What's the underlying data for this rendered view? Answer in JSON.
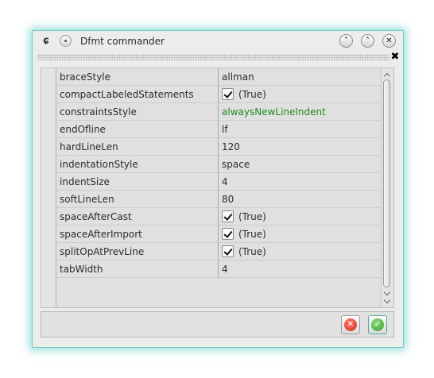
{
  "window": {
    "title": "Dfmt commander",
    "app_icon_glyph": "ɕ",
    "controls": {
      "minimize": "˅",
      "maximize": "˄",
      "close": "✕"
    },
    "dock_close": "✖"
  },
  "properties": [
    {
      "name": "braceStyle",
      "type": "text",
      "value": "allman"
    },
    {
      "name": "compactLabeledStatements",
      "type": "bool",
      "value": "(True)"
    },
    {
      "name": "constraintsStyle",
      "type": "enum",
      "value": "alwaysNewLineIndent",
      "color": "#1f8a1f"
    },
    {
      "name": "endOfline",
      "type": "text",
      "value": "lf"
    },
    {
      "name": "hardLineLen",
      "type": "text",
      "value": "120"
    },
    {
      "name": "indentationStyle",
      "type": "text",
      "value": "space"
    },
    {
      "name": "indentSize",
      "type": "text",
      "value": "4"
    },
    {
      "name": "softLineLen",
      "type": "text",
      "value": "80"
    },
    {
      "name": "spaceAfterCast",
      "type": "bool",
      "value": "(True)"
    },
    {
      "name": "spaceAfterImport",
      "type": "bool",
      "value": "(True)"
    },
    {
      "name": "splitOpAtPrevLine",
      "type": "bool",
      "value": "(True)"
    },
    {
      "name": "tabWidth",
      "type": "text",
      "value": "4"
    }
  ],
  "buttons": {
    "cancel_icon": "cancel-icon",
    "ok_icon": "ok-icon"
  },
  "colors": {
    "accent_glow": "#40c4ba",
    "enum_value": "#1f8a1f"
  }
}
